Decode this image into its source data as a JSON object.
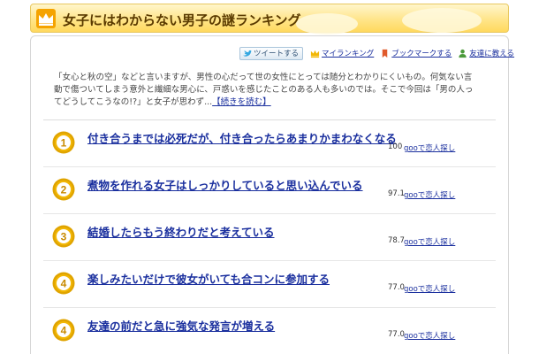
{
  "header": {
    "title": "女子にはわからない男子の謎ランキング"
  },
  "toolbar": {
    "tweet": "ツイートする",
    "my_ranking": "マイランキング",
    "bookmark": "ブックマークする",
    "tell_friend": "友達に教える"
  },
  "intro": {
    "text": "「女心と秋の空」などと言いますが、男性の心だって世の女性にとっては随分とわかりにくいもの。何気ない言動で傷ついてしまう意外と繊細な男心に、戸惑いを感じたことのある人も多いのでは。そこで今回は「男の人ってどうしてこうなの!?」と女子が思わず...",
    "more": "【続きを読む】"
  },
  "ranks": [
    {
      "rank": "1",
      "title": "付き合うまでは必死だが、付き合ったらあまりかまわなくなる",
      "score": "100",
      "link": "gooで恋人探し"
    },
    {
      "rank": "2",
      "title": "煮物を作れる女子はしっかりしていると思い込んでいる",
      "score": "97.1",
      "link": "gooで恋人探し"
    },
    {
      "rank": "3",
      "title": "結婚したらもう終わりだと考えている",
      "score": "78.7",
      "link": "gooで恋人探し"
    },
    {
      "rank": "4",
      "title": "楽しみたいだけで彼女がいても合コンに参加する",
      "score": "77.0",
      "link": "gooで恋人探し"
    },
    {
      "rank": "4",
      "title": "友達の前だと急に強気な発言が増える",
      "score": "77.0",
      "link": "gooで恋人探し"
    }
  ],
  "colors": {
    "gold": "#f2b705",
    "silver_rim": "#e0a400",
    "link": "#1a2f9e"
  }
}
